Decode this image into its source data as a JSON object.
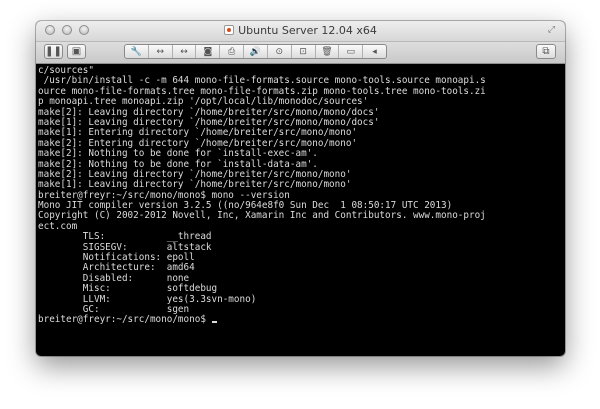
{
  "window": {
    "title": "Ubuntu Server 12.04 x64",
    "traffic_lights": [
      "close",
      "minimize",
      "zoom"
    ]
  },
  "toolbar": {
    "buttons": [
      {
        "name": "pause-button",
        "icon": "pause-icon",
        "glyph": "❚❚"
      },
      {
        "name": "snapshot-button",
        "icon": "snapshot-icon",
        "glyph": "▣"
      }
    ],
    "segment_icons": [
      {
        "name": "settings-wrench-icon",
        "glyph": "🔧"
      },
      {
        "name": "network-arrows-icon",
        "glyph": "↔"
      },
      {
        "name": "network-arrows-2-icon",
        "glyph": "↔"
      },
      {
        "name": "hard-disk-icon",
        "glyph": "◙"
      },
      {
        "name": "printer-icon",
        "glyph": "⎙"
      },
      {
        "name": "sound-icon",
        "glyph": "🔊"
      },
      {
        "name": "camera-icon",
        "glyph": "⊙"
      },
      {
        "name": "usb-icon",
        "glyph": "⊡"
      },
      {
        "name": "trash-icon",
        "glyph": "🗑"
      },
      {
        "name": "display-icon",
        "glyph": "▭"
      },
      {
        "name": "scroll-left-icon",
        "glyph": "◂"
      }
    ],
    "right_button": {
      "name": "fullscreen-button",
      "icon": "fullscreen-icon",
      "glyph": "⧉"
    }
  },
  "terminal": {
    "lines": [
      "c/sources\"",
      " /usr/bin/install -c -m 644 mono-file-formats.source mono-tools.source monoapi.s",
      "ource mono-file-formats.tree mono-file-formats.zip mono-tools.tree mono-tools.zi",
      "p monoapi.tree monoapi.zip '/opt/local/lib/monodoc/sources'",
      "make[2]: Leaving directory `/home/breiter/src/mono/mono/docs'",
      "make[1]: Leaving directory `/home/breiter/src/mono/mono/docs'",
      "make[1]: Entering directory `/home/breiter/src/mono/mono'",
      "make[2]: Entering directory `/home/breiter/src/mono/mono'",
      "make[2]: Nothing to be done for `install-exec-am'.",
      "make[2]: Nothing to be done for `install-data-am'.",
      "make[2]: Leaving directory `/home/breiter/src/mono/mono'",
      "make[1]: Leaving directory `/home/breiter/src/mono/mono'",
      "breiter@freyr:~/src/mono/mono$ mono --version",
      "Mono JIT compiler version 3.2.5 ((no/964e8f0 Sun Dec  1 08:50:17 UTC 2013)",
      "Copyright (C) 2002-2012 Novell, Inc, Xamarin Inc and Contributors. www.mono-proj",
      "ect.com",
      "        TLS:           __thread",
      "        SIGSEGV:       altstack",
      "        Notifications: epoll",
      "        Architecture:  amd64",
      "        Disabled:      none",
      "        Misc:          softdebug",
      "        LLVM:          yes(3.3svn-mono)",
      "        GC:            sgen"
    ],
    "prompt": "breiter@freyr:~/src/mono/mono$ "
  },
  "colors": {
    "terminal_bg": "#000000",
    "terminal_fg": "#dcdcdc",
    "chrome": "#d7d7d7"
  }
}
